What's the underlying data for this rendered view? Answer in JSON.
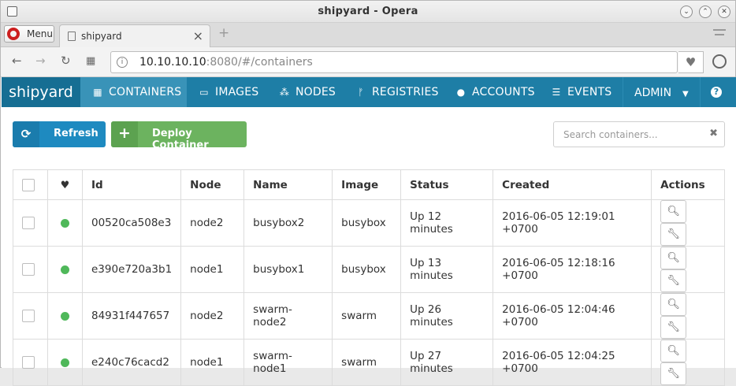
{
  "window": {
    "title": "shipyard - Opera"
  },
  "browser": {
    "menu_label": "Menu",
    "tab_title": "shipyard",
    "url_host": "10.10.10.10",
    "url_rest": ":8080/#/containers"
  },
  "app": {
    "brand": "shipyard",
    "nav": [
      {
        "label": "CONTAINERS",
        "icon": "grid-icon",
        "active": true
      },
      {
        "label": "IMAGES",
        "icon": "hdd-icon"
      },
      {
        "label": "NODES",
        "icon": "sitemap-icon"
      },
      {
        "label": "REGISTRIES",
        "icon": "code-fork-icon"
      },
      {
        "label": "ACCOUNTS",
        "icon": "user-icon"
      },
      {
        "label": "EVENTS",
        "icon": "list-alt-icon"
      }
    ],
    "admin_label": "ADMIN",
    "help_label": "?"
  },
  "toolbar": {
    "refresh_label": "Refresh",
    "deploy_label": "Deploy Container",
    "search_placeholder": "Search containers..."
  },
  "table": {
    "headers": [
      "Id",
      "Node",
      "Name",
      "Image",
      "Status",
      "Created",
      "Actions"
    ],
    "rows": [
      {
        "id": "00520ca508e3",
        "node": "node2",
        "name": "busybox2",
        "image": "busybox",
        "status": "Up 12 minutes",
        "created": "2016-06-05 12:19:01 +0700"
      },
      {
        "id": "e390e720a3b1",
        "node": "node1",
        "name": "busybox1",
        "image": "busybox",
        "status": "Up 13 minutes",
        "created": "2016-06-05 12:18:16 +0700"
      },
      {
        "id": "84931f447657",
        "node": "node2",
        "name": "swarm-node2",
        "image": "swarm",
        "status": "Up 26 minutes",
        "created": "2016-06-05 12:04:46 +0700"
      },
      {
        "id": "e240c76cacd2",
        "node": "node1",
        "name": "swarm-node1",
        "image": "swarm",
        "status": "Up 27 minutes",
        "created": "2016-06-05 12:04:25 +0700"
      }
    ]
  },
  "colors": {
    "navbar": "#1e7ea6",
    "refresh": "#1e8ac0",
    "deploy": "#6cb35f",
    "status_ok": "#4fb85a"
  }
}
